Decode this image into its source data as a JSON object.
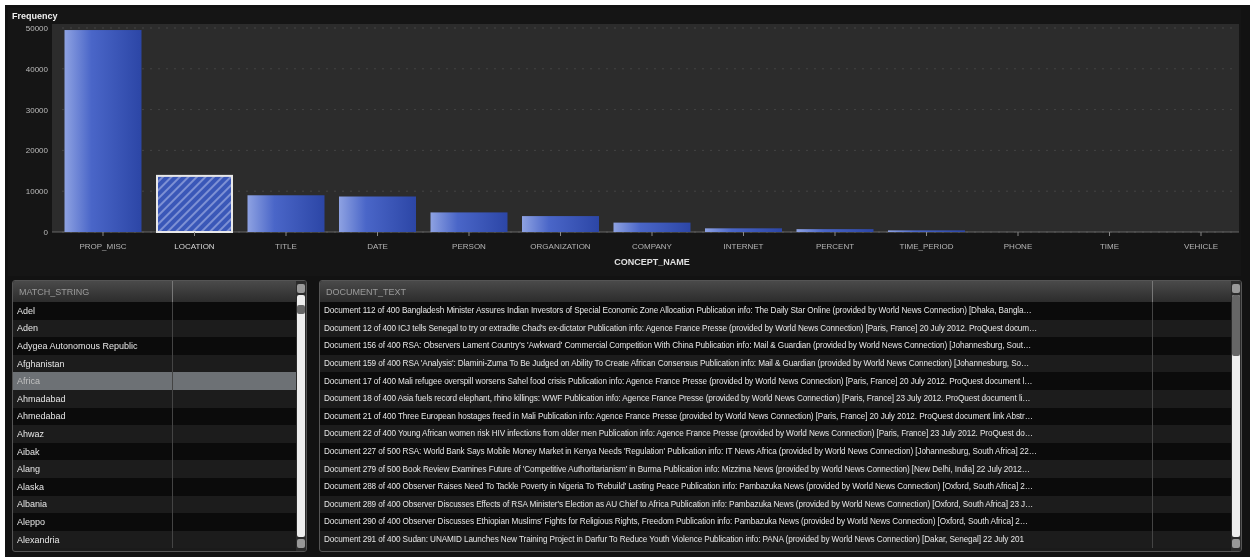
{
  "chart_panel": {
    "title": "Frequency",
    "chart_data": {
      "type": "bar",
      "xlabel": "CONCEPT_NAME",
      "categories": [
        "PROP_MISC",
        "LOCATION",
        "TITLE",
        "DATE",
        "PERSON",
        "ORGANIZATION",
        "COMPANY",
        "INTERNET",
        "PERCENT",
        "TIME_PERIOD",
        "PHONE",
        "TIME",
        "VEHICLE"
      ],
      "values": [
        49500,
        14000,
        9000,
        8700,
        4800,
        3900,
        2300,
        900,
        700,
        400,
        0,
        0,
        0
      ],
      "ylim": [
        0,
        50000
      ],
      "grid": true,
      "yticks": [
        0,
        10000,
        20000,
        30000,
        40000,
        50000
      ]
    },
    "bars": [
      {
        "selected": false
      },
      {
        "selected": true
      },
      {
        "selected": false
      },
      {
        "selected": false
      },
      {
        "selected": false
      },
      {
        "selected": false
      },
      {
        "selected": false
      },
      {
        "selected": false
      },
      {
        "selected": false
      },
      {
        "selected": false
      },
      {
        "selected": false
      },
      {
        "selected": false
      },
      {
        "selected": false
      }
    ]
  },
  "match_table": {
    "columns": [
      "MATCH_STRING"
    ],
    "rows": [
      {
        "text": "Adel",
        "selected": false
      },
      {
        "text": "Aden",
        "selected": false
      },
      {
        "text": "Adygea Autonomous Republic",
        "selected": false
      },
      {
        "text": "Afghanistan",
        "selected": false
      },
      {
        "text": "Africa",
        "selected": true
      },
      {
        "text": "Ahmadabad",
        "selected": false
      },
      {
        "text": "Ahmedabad",
        "selected": false
      },
      {
        "text": "Ahwaz",
        "selected": false
      },
      {
        "text": "Aibak",
        "selected": false
      },
      {
        "text": "Alang",
        "selected": false
      },
      {
        "text": "Alaska",
        "selected": false
      },
      {
        "text": "Albania",
        "selected": false
      },
      {
        "text": "Aleppo",
        "selected": false
      },
      {
        "text": "Alexandria",
        "selected": false
      }
    ]
  },
  "document_table": {
    "columns": [
      "DOCUMENT_TEXT"
    ],
    "rows": [
      "Document 112 of 400 Bangladesh Minister Assures Indian Investors of Special Economic Zone Allocation Publication info: The Daily Star Online (provided by World News Connection) [Dhaka, Bangla…",
      "Document 12 of 400 ICJ tells Senegal to try or extradite Chad's ex-dictator Publication info: Agence France Presse (provided by World News Connection) [Paris, France] 20 July 2012. ProQuest docum…",
      "Document 156 of 400 RSA: Observers Lament Country's 'Awkward' Commercial Competition With China Publication info: Mail & Guardian (provided by World News Connection) [Johannesburg, Sout…",
      "Document 159 of 400 RSA 'Analysis': Dlamini-Zuma To Be Judged on Ability To Create African Consensus Publication info: Mail & Guardian (provided by World News Connection) [Johannesburg, So…",
      "Document 17 of 400 Mali refugee overspill worsens Sahel food crisis Publication info: Agence France Presse (provided by World News Connection) [Paris, France] 20 July 2012. ProQuest document l…",
      "Document 18 of 400 Asia fuels record elephant, rhino killings: WWF Publication info: Agence France Presse (provided by World News Connection) [Paris, France] 23 July 2012. ProQuest document li…",
      "Document 21 of 400 Three European hostages freed in Mali Publication info: Agence France Presse (provided by World News Connection) [Paris, France] 20 July 2012. ProQuest document link Abstr…",
      "Document 22 of 400 Young African women risk HIV infections from older men Publication info: Agence France Presse (provided by World News Connection) [Paris, France] 23 July 2012. ProQuest do…",
      "Document 227 of 500 RSA: World Bank Says Mobile Money Market in Kenya Needs 'Regulation' Publication info: IT News Africa (provided by World News Connection) [Johannesburg, South Africa] 22…",
      "Document 279 of 500 Book Review Examines Future of 'Competitive Authoritarianism' in Burma Publication info: Mizzima News (provided by World News Connection) [New Delhi, India] 22 July 2012…",
      "Document 288 of 400 Observer Raises Need To Tackle Poverty in Nigeria To 'Rebuild' Lasting Peace Publication info: Pambazuka News (provided by World News Connection) [Oxford, South Africa] 2…",
      "Document 289 of 400 Observer Discusses Effects of RSA Minister's Election as AU Chief to Africa Publication info: Pambazuka News (provided by World News Connection) [Oxford, South Africa] 23 J…",
      "Document 290 of 400 Observer Discusses Ethiopian Muslims' Fights for Religious Rights, Freedom Publication info: Pambazuka News (provided by World News Connection) [Oxford, South Africa] 2…",
      "Document 291 of 400 Sudan: UNAMID Launches New Training Project in Darfur To Reduce Youth Violence Publication info: PANA (provided by World News Connection) [Dakar, Senegal] 22 July 201"
    ]
  }
}
